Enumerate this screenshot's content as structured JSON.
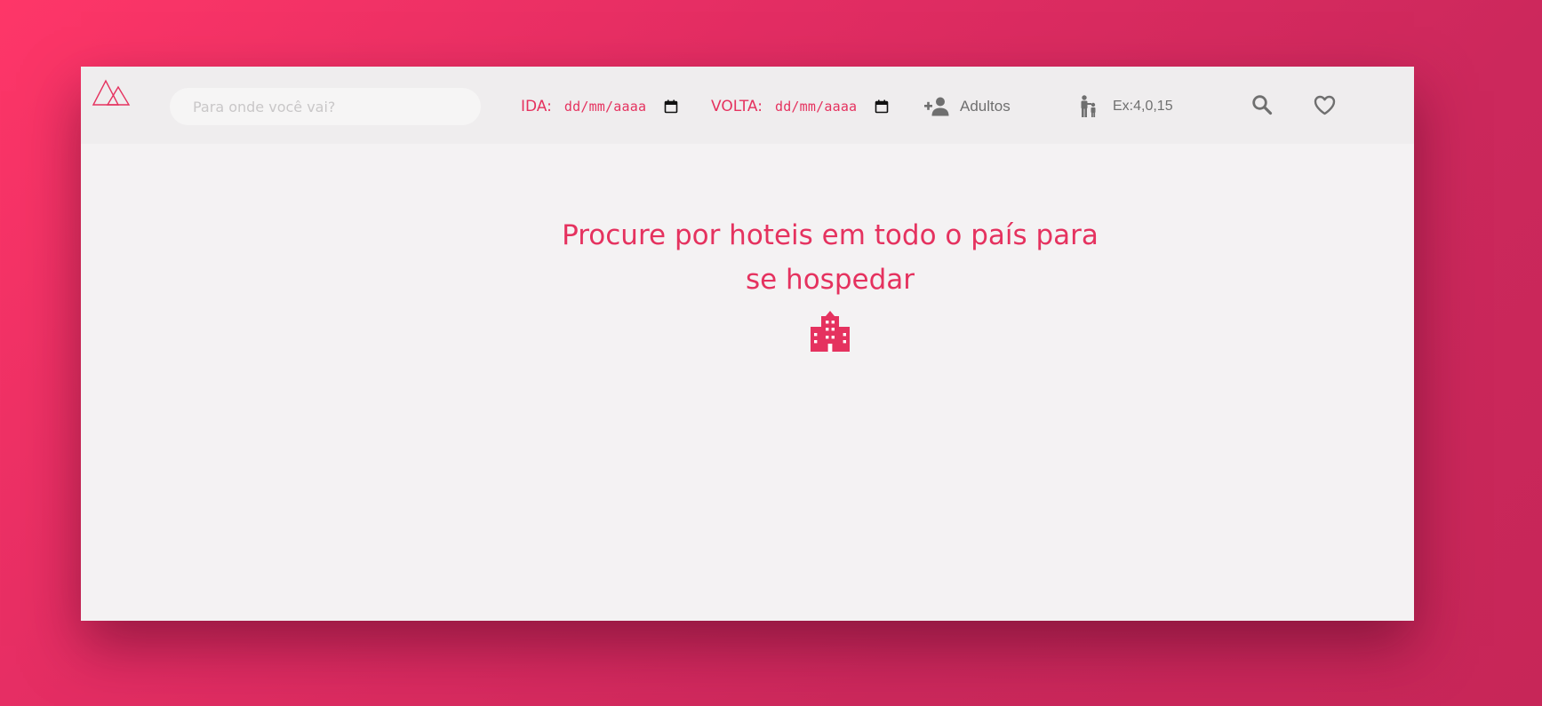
{
  "header": {
    "search": {
      "placeholder": "Para onde você vai?",
      "value": ""
    },
    "departure": {
      "label": "IDA:",
      "value": "dd/mm/aaaa"
    },
    "return": {
      "label": "VOLTA:",
      "value": "dd/mm/aaaa"
    },
    "adults": {
      "icon": "add-person-icon",
      "label": "Adultos"
    },
    "children": {
      "icon": "parent-child-icon",
      "label": "Ex:4,0,15"
    },
    "actions": {
      "search_icon": "search-icon",
      "favorite_icon": "heart-icon"
    }
  },
  "main": {
    "title": "Procure por hoteis em todo o país para se hospedar",
    "icon": "hotel-building-icon"
  },
  "colors": {
    "accent": "#e5325f",
    "icon_gray": "#6f6f6f",
    "card_bg": "#f4f2f3",
    "header_bg": "#efedee"
  }
}
